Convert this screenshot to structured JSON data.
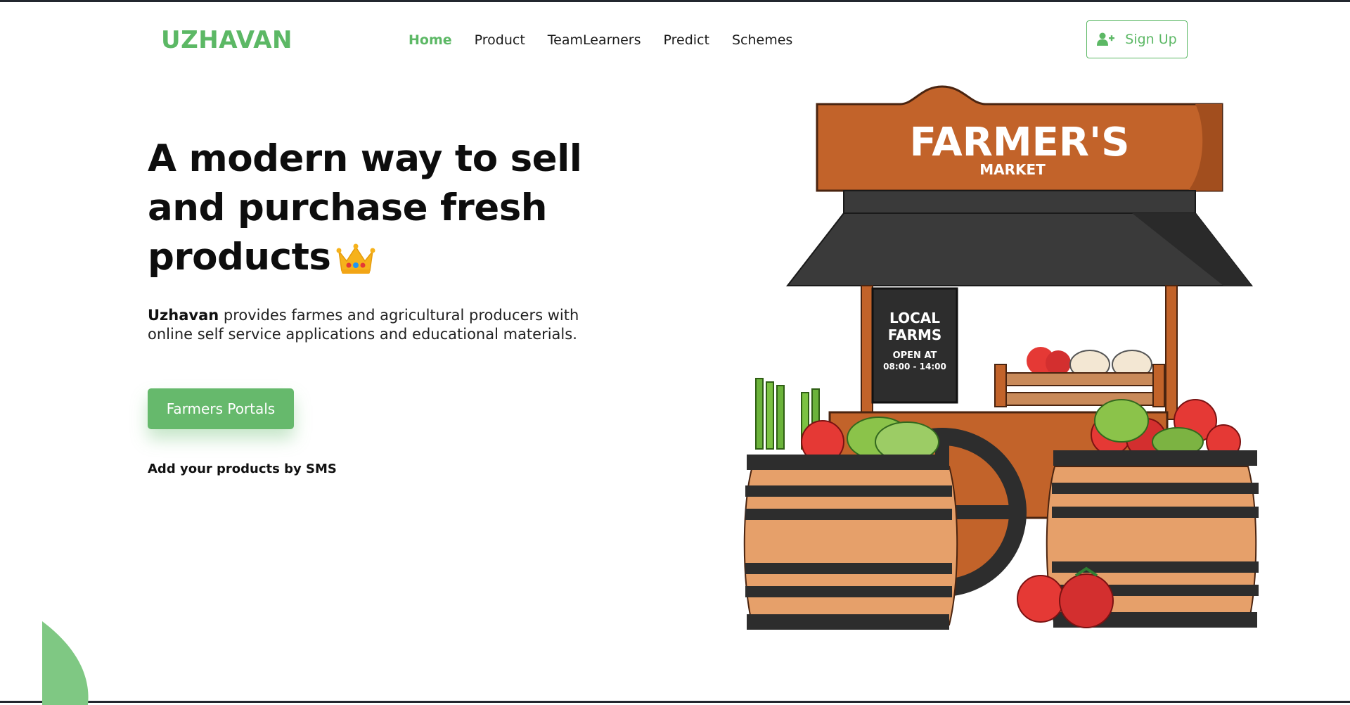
{
  "brand": {
    "name": "UZHAVAN",
    "color": "#5cb865"
  },
  "nav": {
    "items": [
      {
        "label": "Home",
        "active": true
      },
      {
        "label": "Product",
        "active": false
      },
      {
        "label": "TeamLearners",
        "active": false
      },
      {
        "label": "Predict",
        "active": false
      },
      {
        "label": "Schemes",
        "active": false
      }
    ],
    "signup_label": "Sign Up",
    "signup_icon": "user-plus-icon"
  },
  "hero": {
    "title_line1": "A modern way to sell",
    "title_line2": "and purchase fresh",
    "title_line3": "products",
    "title_icon": "crown-icon",
    "desc_brand": "Uzhavan",
    "desc_line1": " provides farmes and agricultural producers with",
    "desc_line2": "online self service applications and educational materials.",
    "cta_label": "Farmers Portals",
    "sms_text": "Add your products by SMS"
  },
  "illustration": {
    "sign_title": "FARMER'S",
    "sign_subtitle": "MARKET",
    "board_line1": "LOCAL",
    "board_line2": "FARMS",
    "board_line3": "OPEN AT",
    "board_line4": "08:00 - 14:00"
  },
  "colors": {
    "accent": "#5cb865",
    "wood": "#c2632a",
    "awning": "#3a3a3a"
  }
}
